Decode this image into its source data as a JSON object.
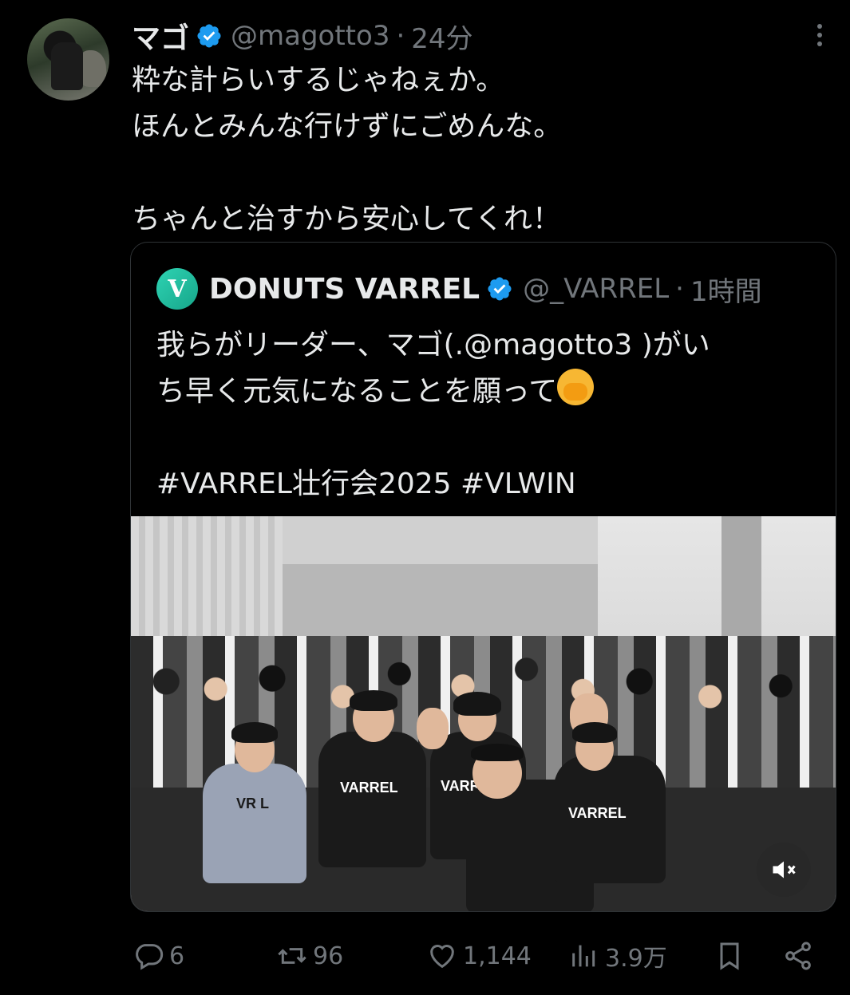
{
  "tweet": {
    "display_name": "マゴ",
    "handle": "@magotto3",
    "separator": "·",
    "time": "24分",
    "text": "粋な計らいするじゃねぇか。\nほんとみんな行けずにごめんな。\n\nちゃんと治すから安心してくれ！"
  },
  "quote": {
    "display_name": "DONUTS VARREL",
    "logo_letter": "V",
    "handle": "@_VARREL",
    "separator": "·",
    "time": "1時間",
    "text_line1": "我らがリーダー、マゴ(.@magotto3 )がい",
    "text_line2": "ち早く元気になることを願って",
    "text_line3": "",
    "text_line4": "#VARREL壮行会2025 #VLWIN",
    "media": {
      "shirt_text_1": "VARREL",
      "shirt_text_2": "VARREL",
      "shirt_text_3": "VARREL",
      "shirt_text_4": "VR L"
    }
  },
  "actions": {
    "reply_count": "6",
    "retweet_count": "96",
    "like_count": "1,144",
    "views_count": "3.9万"
  },
  "colors": {
    "background": "#000000",
    "text": "#e7e9ea",
    "secondary": "#71767b",
    "verified": "#1d9bf0",
    "border": "#2f3336",
    "varrel_brand": "#2ed3b3"
  },
  "icons": [
    "verified-badge-icon",
    "more-icon",
    "mute-icon",
    "reply-icon",
    "retweet-icon",
    "like-icon",
    "views-icon",
    "bookmark-icon",
    "share-icon"
  ]
}
